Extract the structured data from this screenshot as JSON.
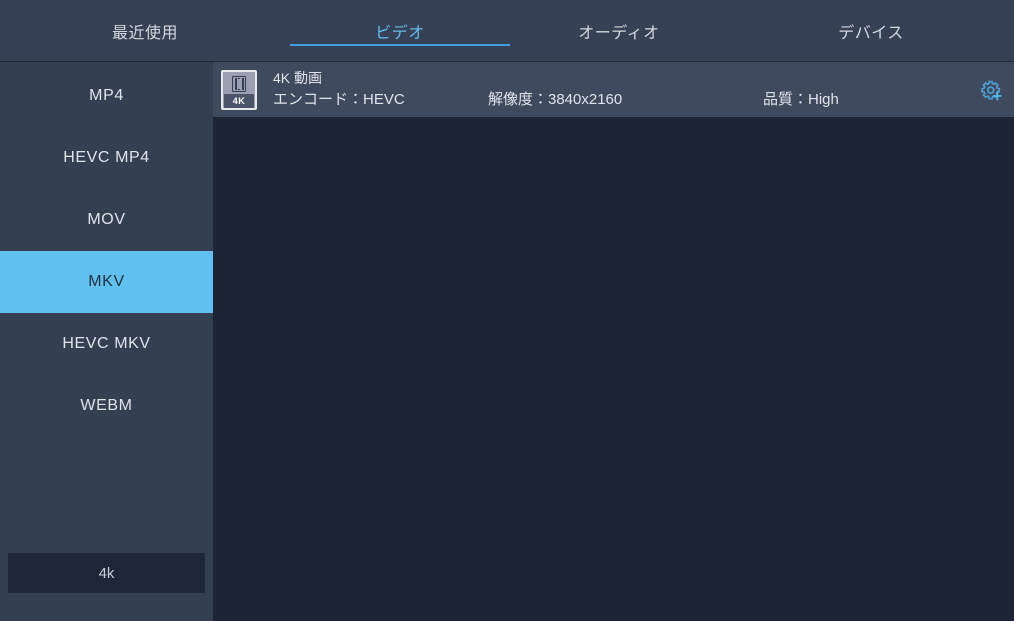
{
  "window": {
    "background": "#1d2433",
    "accent": "#60c0ef"
  },
  "tabs": {
    "items": [
      {
        "id": "recent",
        "label": "最近使用",
        "active": false
      },
      {
        "id": "video",
        "label": "ビデオ",
        "active": true
      },
      {
        "id": "audio",
        "label": "オーディオ",
        "active": false
      },
      {
        "id": "device",
        "label": "デバイス",
        "active": false
      }
    ],
    "active_indicator_color": "#3d9fe0"
  },
  "sidebar": {
    "items": [
      {
        "id": "mp4",
        "label": "MP4",
        "selected": false
      },
      {
        "id": "hevc-mp4",
        "label": "HEVC MP4",
        "selected": false
      },
      {
        "id": "mov",
        "label": "MOV",
        "selected": false
      },
      {
        "id": "mkv",
        "label": "MKV",
        "selected": true
      },
      {
        "id": "hevc-mkv",
        "label": "HEVC MKV",
        "selected": false
      },
      {
        "id": "webm",
        "label": "WEBM",
        "selected": false
      }
    ],
    "selected_background": "#60c0ef",
    "bottom_button": {
      "id": "resolution-filter-4k",
      "label": "4k"
    }
  },
  "main": {
    "preset": {
      "icon": {
        "name": "film-strip-icon",
        "badge": "4K"
      },
      "title": "4K 動画",
      "encode_label": "エンコード：HEVC",
      "resolution_label": "解像度：3840x2160",
      "quality_label": "品質：High",
      "settings_icon": "gear-plus-icon"
    }
  }
}
